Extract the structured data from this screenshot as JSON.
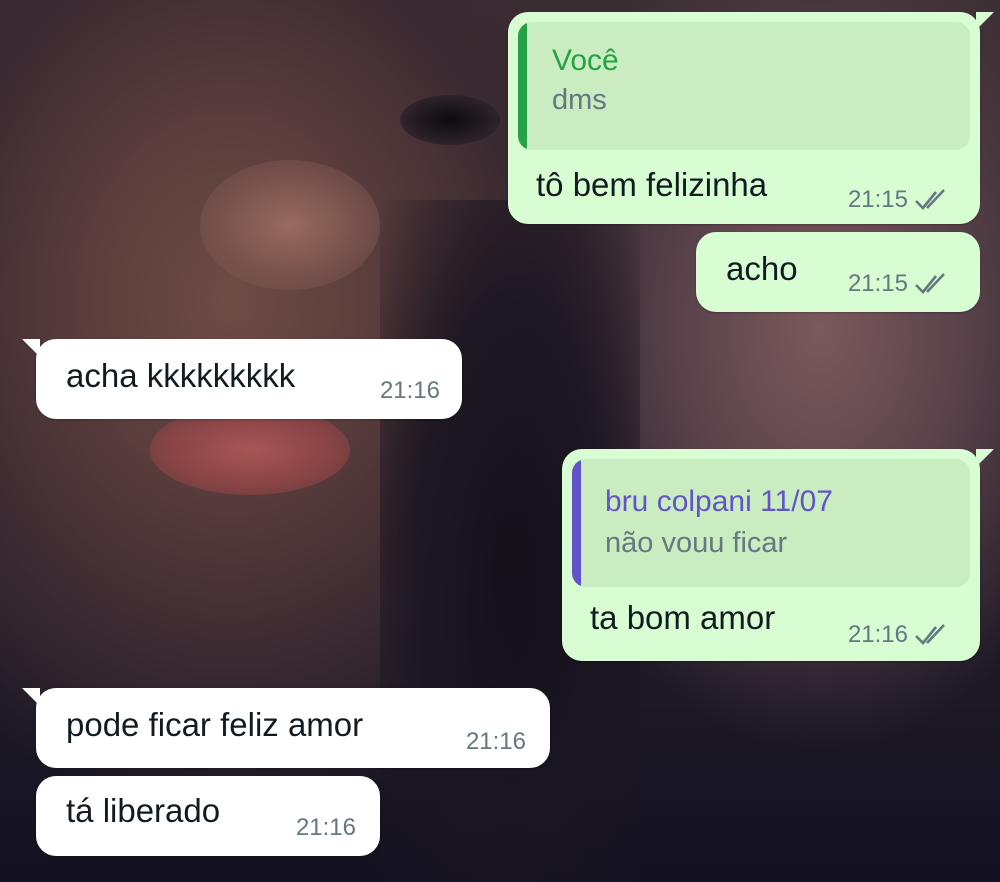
{
  "colors": {
    "outgoing_bubble": "#d9fdd3",
    "incoming_bubble": "#ffffff",
    "quote_self_bar": "#25a244",
    "quote_other_bar": "#6254c8",
    "read_ticks": "#667781"
  },
  "messages": [
    {
      "direction": "outgoing",
      "quote": {
        "author": "Você",
        "text": "dms"
      },
      "text": "tô bem felizinha",
      "time": "21:15",
      "status_icon": "double-check-icon"
    },
    {
      "direction": "outgoing",
      "text": "acho",
      "time": "21:15",
      "status_icon": "double-check-icon"
    },
    {
      "direction": "incoming",
      "text": "acha kkkkkkkkk",
      "time": "21:16"
    },
    {
      "direction": "outgoing",
      "quote": {
        "author": "bru colpani 11/07",
        "text": "não vouu ficar"
      },
      "text": "ta bom amor",
      "time": "21:16",
      "status_icon": "double-check-icon"
    },
    {
      "direction": "incoming",
      "text": "pode ficar feliz amor",
      "time": "21:16"
    },
    {
      "direction": "incoming",
      "text": "tá liberado",
      "time": "21:16"
    }
  ]
}
